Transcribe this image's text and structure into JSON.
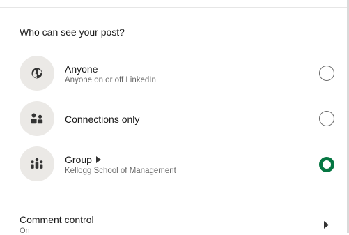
{
  "visibility": {
    "heading": "Who can see your post?",
    "options": [
      {
        "title": "Anyone",
        "subtitle": "Anyone on or off LinkedIn",
        "icon": "globe-icon",
        "selected": false
      },
      {
        "title": "Connections only",
        "subtitle": "",
        "icon": "people-icon",
        "selected": false
      },
      {
        "title": "Group",
        "subtitle": "Kellogg School of Management",
        "icon": "group-icon",
        "selected": true
      }
    ]
  },
  "comment_control": {
    "label": "Comment control",
    "value": "On",
    "icon": "chevron-right-icon"
  },
  "colors": {
    "selected_radio": "#057642",
    "icon_background": "#ebe9e6"
  }
}
